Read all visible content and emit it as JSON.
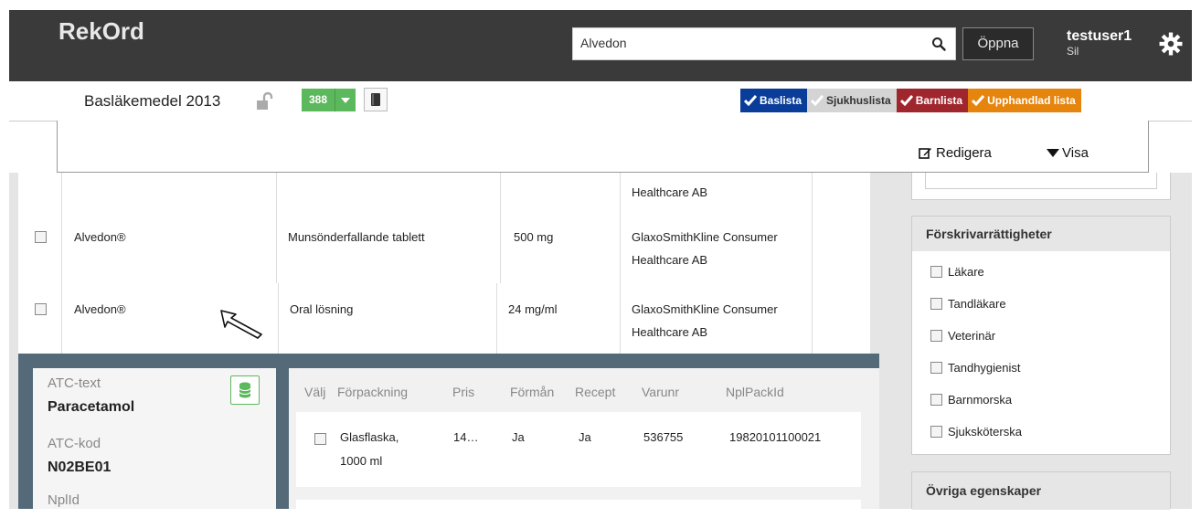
{
  "app": {
    "brand": "RekOrd"
  },
  "search": {
    "value": "Alvedon",
    "open_label": "Öppna"
  },
  "user": {
    "name": "testuser1",
    "role": "Sil"
  },
  "list": {
    "title": "Basläkemedel 2013",
    "count": "388"
  },
  "tags": [
    {
      "label": "Baslista",
      "color": "#0a3d9a"
    },
    {
      "label": "Sjukhuslista",
      "color": "#d4d4d4"
    },
    {
      "label": "Barnlista",
      "color": "#a0262d"
    },
    {
      "label": "Upphandlad lista",
      "color": "#e6850e"
    }
  ],
  "toolbar": {
    "edit_label": "Redigera",
    "show_label": "Visa"
  },
  "rows": [
    {
      "name": "",
      "form": "",
      "strength": "",
      "company_1": "",
      "company_2": "Healthcare AB"
    },
    {
      "name": "Alvedon®",
      "form": "Munsönderfallande tablett",
      "strength": "500 mg",
      "company_1": "GlaxoSmithKline Consumer",
      "company_2": "Healthcare AB"
    },
    {
      "name": "Alvedon®",
      "form": "Oral lösning",
      "strength": "24 mg/ml",
      "company_1": "GlaxoSmithKline Consumer",
      "company_2": "Healthcare AB"
    }
  ],
  "detail": {
    "atc_text_label": "ATC-text",
    "atc_text": "Paracetamol",
    "atc_code_label": "ATC-kod",
    "atc_code": "N02BE01",
    "nplid_label": "NplId",
    "headers": [
      "Välj",
      "Förpackning",
      "Pris",
      "Förmån",
      "Recept",
      "Varunr",
      "NplPackId"
    ],
    "package": {
      "name_1": "Glasflaska,",
      "name_2": "1000 ml",
      "price": "14…",
      "benefit": "Ja",
      "prescription": "Ja",
      "item_no": "536755",
      "npl_pack_id": "19820101100021"
    }
  },
  "sidebar": {
    "prescriber_title": "Förskrivarrättigheter",
    "prescribers": [
      "Läkare",
      "Tandläkare",
      "Veterinär",
      "Tandhygienist",
      "Barnmorska",
      "Sjuksköterska"
    ],
    "other_title": "Övriga egenskaper"
  }
}
